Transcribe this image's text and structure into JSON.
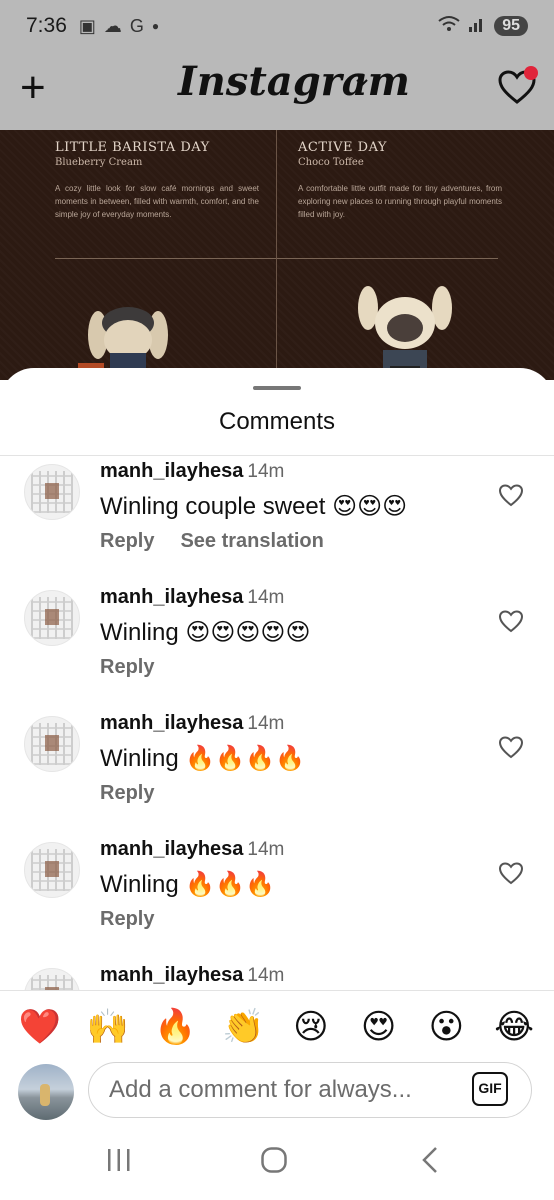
{
  "status_bar": {
    "time": "7:36",
    "battery": "95",
    "icons": [
      "screenshot-icon",
      "cloud-icon",
      "google-icon",
      "dot-icon",
      "wifi-icon",
      "signal-icon"
    ]
  },
  "header": {
    "app_title": "Instagram",
    "icons": [
      "plus-icon",
      "chevron-down-icon",
      "heart-icon"
    ]
  },
  "post": {
    "left": {
      "heading": "LITTLE BARISTA DAY",
      "subheading": "Blueberry Cream",
      "description": "A cozy little look for slow café mornings and sweet moments in between, filled with warmth, comfort, and the simple joy of everyday moments."
    },
    "right": {
      "heading": "ACTIVE DAY",
      "subheading": "Choco Toffee",
      "description": "A comfortable little outfit made for tiny adventures, from exploring new places to running through playful moments filled with joy."
    }
  },
  "comments_sheet": {
    "title": "Comments",
    "comments": [
      {
        "username": "manh_ilayhesa",
        "time": "14m",
        "text": "Winling couple sweet 😍😍😍",
        "reply": "Reply",
        "translate": "See translation"
      },
      {
        "username": "manh_ilayhesa",
        "time": "14m",
        "text": "Winling 😍😍😍😍😍",
        "reply": "Reply"
      },
      {
        "username": "manh_ilayhesa",
        "time": "14m",
        "text": "Winling 🔥🔥🔥🔥",
        "reply": "Reply"
      },
      {
        "username": "manh_ilayhesa",
        "time": "14m",
        "text": "Winling 🔥🔥🔥",
        "reply": "Reply"
      },
      {
        "username": "manh_ilayhesa",
        "time": "14m"
      }
    ]
  },
  "emoji_bar": [
    "❤️",
    "🙌",
    "🔥",
    "👏",
    "😢",
    "😍",
    "😮",
    "😂"
  ],
  "input": {
    "placeholder": "Add a comment for always...",
    "gif_label": "GIF"
  },
  "colors": {
    "accent_red": "#e0243a",
    "post_bg": "#2c1a12",
    "dim_overlay": "#b9b9b9"
  }
}
